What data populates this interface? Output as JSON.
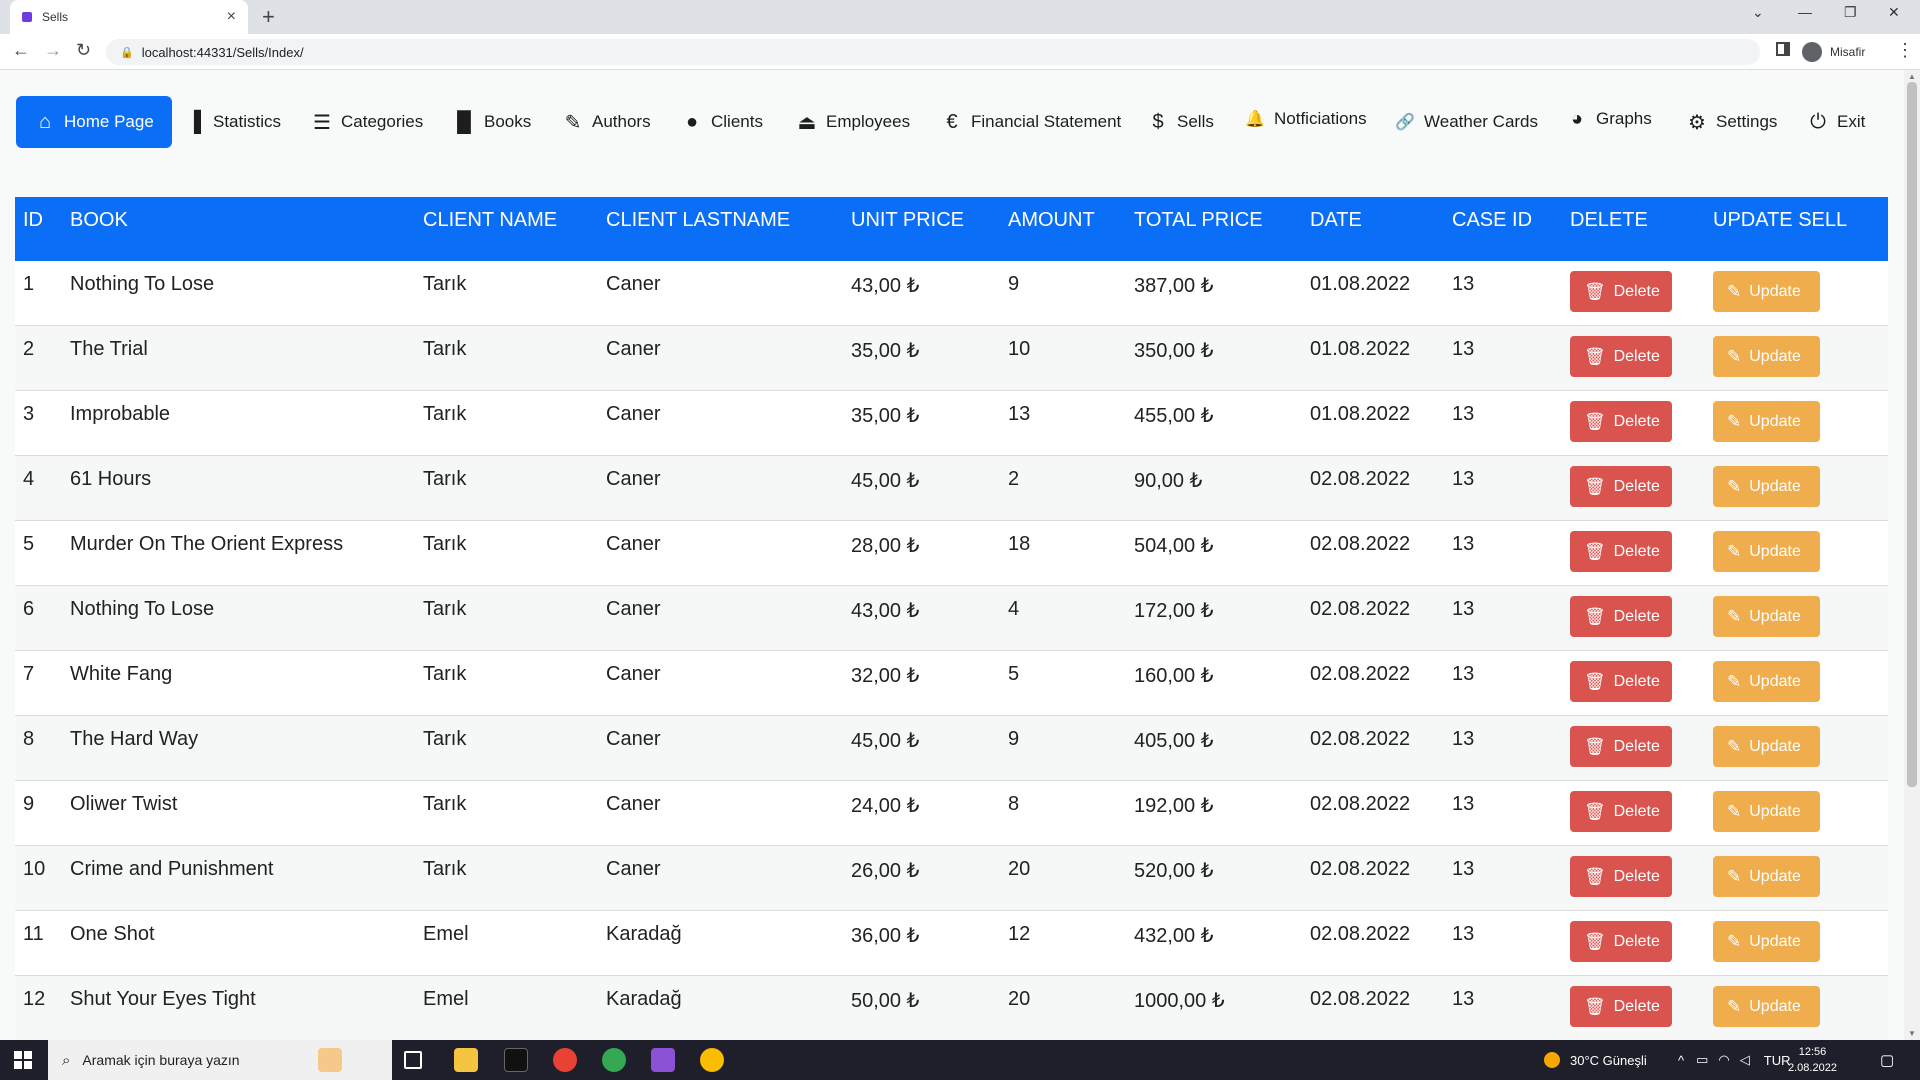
{
  "browser": {
    "tab_title": "Sells",
    "tab_close": "×",
    "new_tab": "+",
    "url": "localhost:44331/Sells/Index/",
    "profile_name": "Misafir"
  },
  "nav": {
    "items": [
      {
        "label": "Home Page",
        "icon": "home-icon",
        "glyph": "⌂"
      },
      {
        "label": "Statistics",
        "icon": "bar-chart-icon",
        "glyph": "▐"
      },
      {
        "label": "Categories",
        "icon": "list-icon",
        "glyph": "☰"
      },
      {
        "label": "Books",
        "icon": "book-icon",
        "glyph": "▉"
      },
      {
        "label": "Authors",
        "icon": "pencil-icon",
        "glyph": "✎"
      },
      {
        "label": "Clients",
        "icon": "user-icon",
        "glyph": "●"
      },
      {
        "label": "Employees",
        "icon": "eject-icon",
        "glyph": "⏏"
      },
      {
        "label": "Financial Statement",
        "icon": "euro-icon",
        "glyph": "€"
      },
      {
        "label": "Sells",
        "icon": "dollar-icon",
        "glyph": "$"
      },
      {
        "label": "Notficiations",
        "icon": "bell-icon",
        "glyph": "🔔"
      },
      {
        "label": "Weather Cards",
        "icon": "link-icon",
        "glyph": "🔗"
      },
      {
        "label": "Graphs",
        "icon": "pie-chart-icon",
        "glyph": "◕"
      },
      {
        "label": "Settings",
        "icon": "gear-icon",
        "glyph": "⚙"
      },
      {
        "label": "Exit",
        "icon": "power-icon",
        "glyph": "⏻"
      }
    ]
  },
  "table": {
    "headers": [
      "ID",
      "BOOK",
      "CLIENT NAME",
      "CLIENT LASTNAME",
      "UNIT PRICE",
      "AMOUNT",
      "TOTAL PRICE",
      "DATE",
      "CASE ID",
      "DELETE",
      "UPDATE SELL"
    ],
    "delete_label": "Delete",
    "update_label": "Update",
    "rows": [
      [
        "1",
        "Nothing To Lose",
        "Tarık",
        "Caner",
        "43,00 ₺",
        "9",
        "387,00 ₺",
        "01.08.2022",
        "13"
      ],
      [
        "2",
        "The Trial",
        "Tarık",
        "Caner",
        "35,00 ₺",
        "10",
        "350,00 ₺",
        "01.08.2022",
        "13"
      ],
      [
        "3",
        "Improbable",
        "Tarık",
        "Caner",
        "35,00 ₺",
        "13",
        "455,00 ₺",
        "01.08.2022",
        "13"
      ],
      [
        "4",
        "61 Hours",
        "Tarık",
        "Caner",
        "45,00 ₺",
        "2",
        "90,00 ₺",
        "02.08.2022",
        "13"
      ],
      [
        "5",
        "Murder On The Orient Express",
        "Tarık",
        "Caner",
        "28,00 ₺",
        "18",
        "504,00 ₺",
        "02.08.2022",
        "13"
      ],
      [
        "6",
        "Nothing To Lose",
        "Tarık",
        "Caner",
        "43,00 ₺",
        "4",
        "172,00 ₺",
        "02.08.2022",
        "13"
      ],
      [
        "7",
        "White Fang",
        "Tarık",
        "Caner",
        "32,00 ₺",
        "5",
        "160,00 ₺",
        "02.08.2022",
        "13"
      ],
      [
        "8",
        "The Hard Way",
        "Tarık",
        "Caner",
        "45,00 ₺",
        "9",
        "405,00 ₺",
        "02.08.2022",
        "13"
      ],
      [
        "9",
        "Oliwer Twist",
        "Tarık",
        "Caner",
        "24,00 ₺",
        "8",
        "192,00 ₺",
        "02.08.2022",
        "13"
      ],
      [
        "10",
        "Crime and Punishment",
        "Tarık",
        "Caner",
        "26,00 ₺",
        "20",
        "520,00 ₺",
        "02.08.2022",
        "13"
      ],
      [
        "11",
        "One Shot",
        "Emel",
        "Karadağ",
        "36,00 ₺",
        "12",
        "432,00 ₺",
        "02.08.2022",
        "13"
      ],
      [
        "12",
        "Shut Your Eyes Tight",
        "Emel",
        "Karadağ",
        "50,00 ₺",
        "20",
        "1000,00 ₺",
        "02.08.2022",
        "13"
      ]
    ]
  },
  "taskbar": {
    "search_placeholder": "Aramak için buraya yazın",
    "weather": "30°C  Güneşli",
    "language": "TUR",
    "time": "12:56",
    "date": "2.08.2022"
  },
  "colors": {
    "primary": "#0b6ef6",
    "danger": "#d9534f",
    "warning": "#f0ad4e"
  }
}
